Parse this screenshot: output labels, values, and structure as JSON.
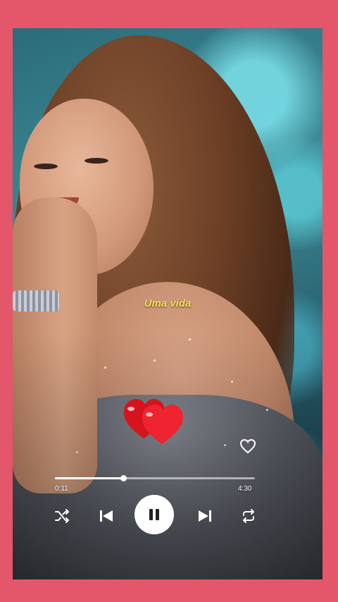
{
  "player": {
    "lyric": "Uma vida",
    "elapsed_time": "0:11",
    "total_time": "4:30",
    "progress": 0.34,
    "liked": false
  },
  "icons": {
    "like": "heart-outline-icon",
    "shuffle": "shuffle-icon",
    "previous": "skip-previous-icon",
    "play_pause": "pause-icon",
    "next": "skip-next-icon",
    "repeat": "repeat-icon",
    "decoration": "red-hearts-icon"
  },
  "colors": {
    "frame": "#e4566a",
    "lyric": "#f5e04a",
    "heart": "#e8202a",
    "controls": "#ffffff"
  }
}
